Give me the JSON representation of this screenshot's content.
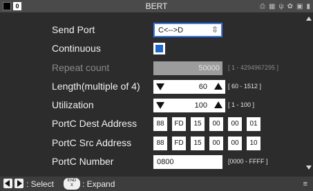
{
  "titlebar": {
    "badge": "0",
    "title": "BERT",
    "icons": [
      "printer-icon",
      "network-icon",
      "usb-icon",
      "tool-icon",
      "storage-icon",
      "battery-icon"
    ]
  },
  "rows": {
    "send_port": {
      "label": "Send Port",
      "value": "C<-->D"
    },
    "continuous": {
      "label": "Continuous",
      "checked": true
    },
    "repeat_count": {
      "label": "Repeat count",
      "value": "50000",
      "range": "[ 1 - 4294967295 ]"
    },
    "length": {
      "label": "Length(multiple of 4)",
      "value": "60",
      "range": "[ 60 - 1512 ]"
    },
    "utilization": {
      "label": "Utilization",
      "value": "100",
      "range": "[ 1 - 100 ]"
    },
    "dest_address": {
      "label": "PortC Dest Address",
      "bytes": [
        "88",
        "FD",
        "15",
        "00",
        "00",
        "01"
      ]
    },
    "src_address": {
      "label": "PortC Src Address",
      "bytes": [
        "88",
        "FD",
        "15",
        "00",
        "00",
        "10"
      ]
    },
    "portc_number": {
      "label": "PortC Number",
      "value": "0800",
      "range": "[0000 - FFFF ]"
    }
  },
  "footer": {
    "select_text": ": Select",
    "end_key_top": "END",
    "end_key_bottom": "X",
    "expand_text": ": Expand"
  },
  "colors": {
    "accent": "#1e66c8",
    "focus_border": "#3b78e7",
    "background": "#2c2c2c"
  }
}
